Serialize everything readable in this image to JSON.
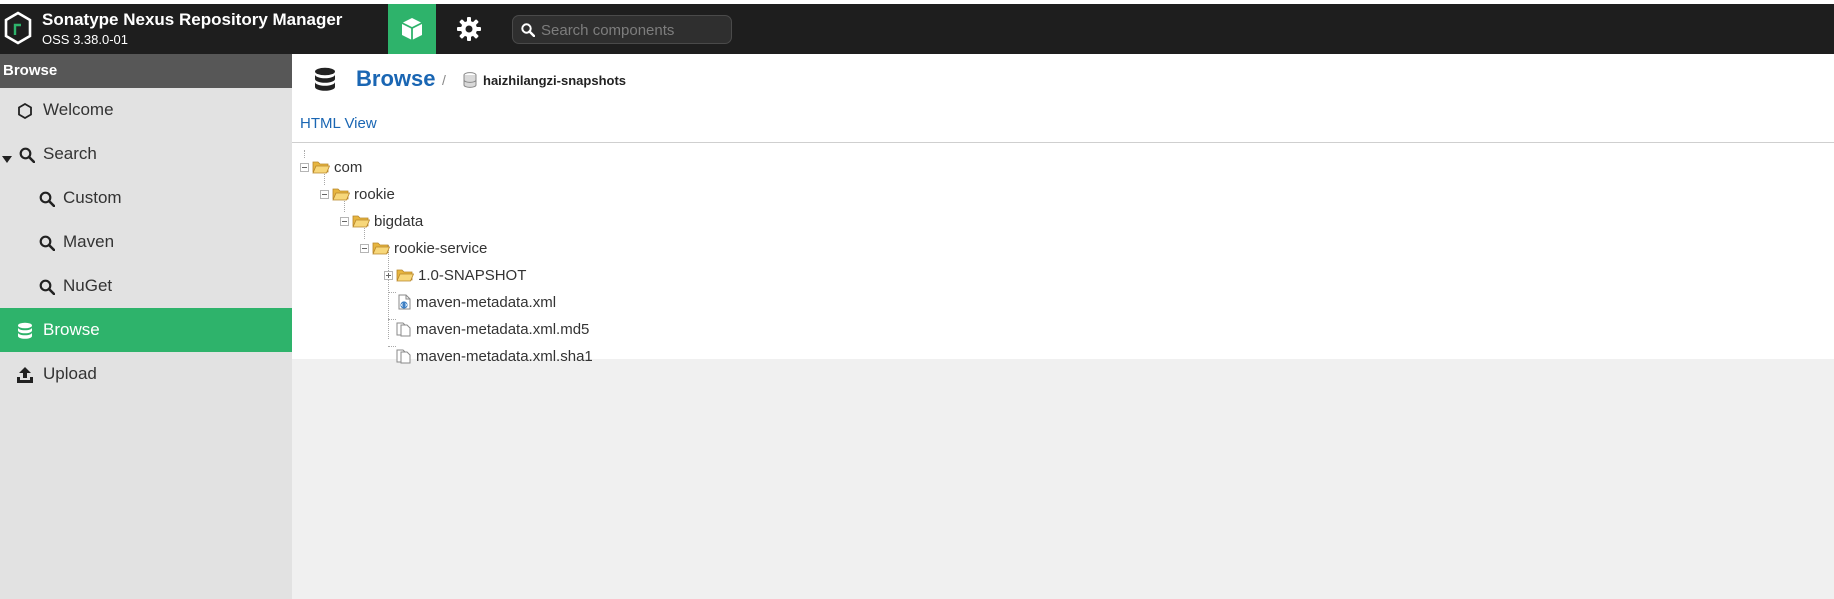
{
  "app": {
    "title": "Sonatype Nexus Repository Manager",
    "version": "OSS 3.38.0-01"
  },
  "toolbar": {
    "browse_mode_icon": "cube-icon",
    "admin_mode_icon": "gear-icon",
    "search_placeholder": "Search components"
  },
  "sidebar": {
    "header": "Browse",
    "items": [
      {
        "label": "Welcome",
        "icon": "hexagon-icon"
      },
      {
        "label": "Search",
        "icon": "search-icon",
        "expanded": true
      },
      {
        "label": "Custom",
        "icon": "search-icon"
      },
      {
        "label": "Maven",
        "icon": "search-icon"
      },
      {
        "label": "NuGet",
        "icon": "search-icon"
      },
      {
        "label": "Browse",
        "icon": "database-icon",
        "active": true
      },
      {
        "label": "Upload",
        "icon": "upload-icon"
      }
    ]
  },
  "main": {
    "title": "Browse",
    "breadcrumb_sep": "/",
    "repository": "haizhilangzi-snapshots",
    "html_view": "HTML View"
  },
  "tree": [
    {
      "label": "com",
      "type": "folder",
      "depth": 0,
      "expander": "minus"
    },
    {
      "label": "rookie",
      "type": "folder",
      "depth": 1,
      "expander": "minus"
    },
    {
      "label": "bigdata",
      "type": "folder",
      "depth": 2,
      "expander": "minus"
    },
    {
      "label": "rookie-service",
      "type": "folder",
      "depth": 3,
      "expander": "minus"
    },
    {
      "label": "1.0-SNAPSHOT",
      "type": "folder",
      "depth": 4,
      "expander": "plus"
    },
    {
      "label": "maven-metadata.xml",
      "type": "xml",
      "depth": 4
    },
    {
      "label": "maven-metadata.xml.md5",
      "type": "file",
      "depth": 4
    },
    {
      "label": "maven-metadata.xml.sha1",
      "type": "file",
      "depth": 4
    }
  ],
  "colors": {
    "accent_green": "#2eb36b",
    "link_blue": "#1a66b3",
    "header_bg": "#1e1e1e",
    "folder_yellow": "#f3c552"
  }
}
